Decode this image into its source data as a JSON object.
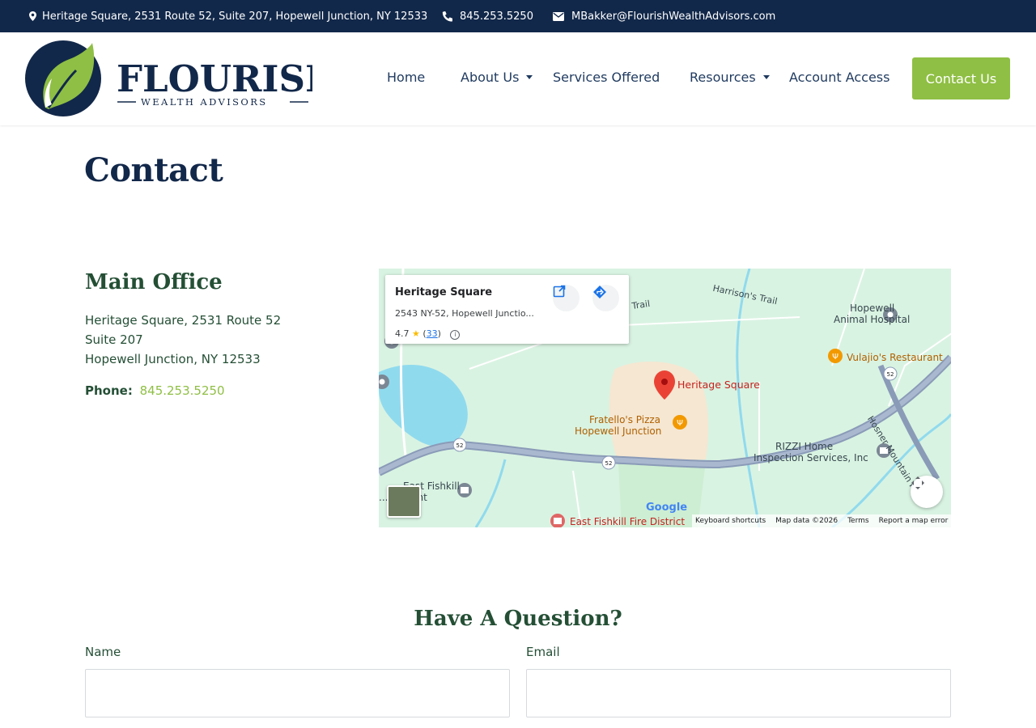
{
  "topbar": {
    "address": "Heritage Square, 2531 Route 52, Suite 207, Hopewell Junction, NY 12533",
    "phone": "845.253.5250",
    "email": "MBakker@FlourishWealthAdvisors.com",
    "icons": [
      "map-pin-icon",
      "phone-icon",
      "envelope-icon"
    ]
  },
  "brand": {
    "name": "FLOURISH",
    "tagline": "WEALTH ADVISORS",
    "colors": {
      "navy": "#12284a",
      "green": "#8fbf44",
      "dark_green": "#244f35"
    }
  },
  "nav": {
    "items": [
      {
        "label": "Home",
        "dropdown": false
      },
      {
        "label": "About Us",
        "dropdown": true
      },
      {
        "label": "Services Offered",
        "dropdown": false
      },
      {
        "label": "Resources",
        "dropdown": true
      },
      {
        "label": "Account Access",
        "dropdown": false
      }
    ],
    "cta": "Contact Us"
  },
  "page": {
    "title": "Contact"
  },
  "office": {
    "title": "Main Office",
    "address_lines": [
      "Heritage Square, 2531 Route 52",
      "Suite 207",
      "Hopewell Junction, NY 12533"
    ],
    "phone_label": "Phone:",
    "phone": "845.253.5250"
  },
  "map": {
    "card": {
      "name": "Heritage Square",
      "address": "2543 NY-52, Hopewell Junctio...",
      "rating": "4.7",
      "reviews": "33"
    },
    "labels": [
      "Heritage Square",
      "Fratello's Pizza",
      "Hopewell Junction",
      "Hopewell",
      "Animal Hospital",
      "Vulajio's Restaurant",
      "RIZZI Home",
      "Inspection Services, Inc",
      "East Fishkill",
      "...artment",
      "East Fishkill Fire District",
      "Harrison's Trail",
      "...'s Trail",
      "Hosner Mountain Rd",
      "52"
    ],
    "footer": [
      "Keyboard shortcuts",
      "Map data ©2026",
      "Terms",
      "Report a map error"
    ],
    "logo": "Google"
  },
  "form": {
    "heading": "Have A Question?",
    "name_label": "Name",
    "email_label": "Email",
    "name_value": "",
    "email_value": ""
  }
}
